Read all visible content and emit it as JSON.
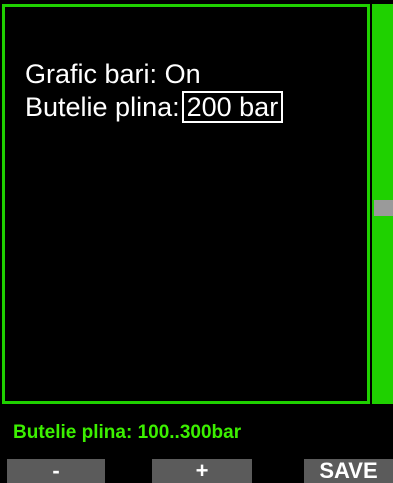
{
  "settings": {
    "graph_label": "Grafic bari:",
    "graph_value": "On",
    "full_tank_label": "Butelie plina:",
    "full_tank_value": "200 bar"
  },
  "hint": "Butelie plina: 100..300bar",
  "softkeys": {
    "minus": "-",
    "plus": "+",
    "save": "SAVE"
  },
  "colors": {
    "accent": "#1fd100",
    "hint": "#3cf000",
    "softkey_bg": "#5b5b5b"
  }
}
